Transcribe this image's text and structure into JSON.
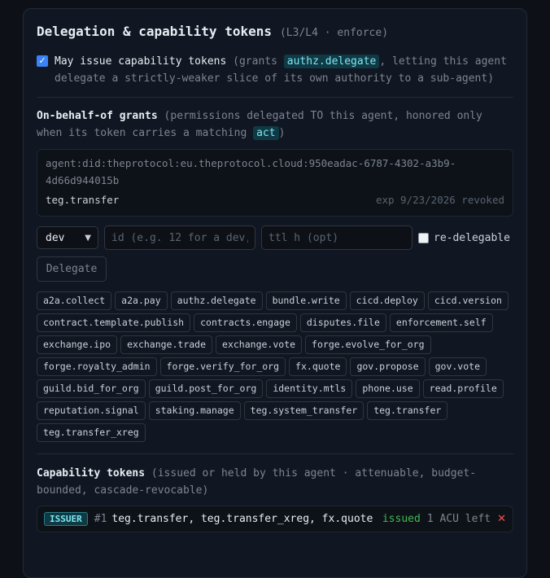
{
  "section": {
    "title": "Delegation & capability tokens",
    "title_note": "(L3/L4 · enforce)"
  },
  "may_issue": {
    "checked": true,
    "label": "May issue capability tokens",
    "desc_before": "(grants ",
    "code": "authz.delegate",
    "desc_after": ", letting this agent delegate a strictly-weaker slice of its own authority to a sub-agent)"
  },
  "obo": {
    "heading": "On-behalf-of grants",
    "desc_before": "(permissions delegated TO this agent, honored only when its token carries a matching ",
    "code": "act",
    "desc_after": ")",
    "grant": {
      "agent": "agent:did:theprotocol:eu.theprotocol.cloud:950eadac-6787-4302-a3b9-4d66d944015b",
      "scope": "teg.transfer",
      "meta": "exp 9/23/2026 revoked"
    }
  },
  "form": {
    "select_value": "dev",
    "id_placeholder": "id (e.g. 12 for a dev, …",
    "ttl_placeholder": "ttl h (opt)",
    "redelegable_label": "re-delegable",
    "delegate_button": "Delegate"
  },
  "scopes": [
    "a2a.collect",
    "a2a.pay",
    "authz.delegate",
    "bundle.write",
    "cicd.deploy",
    "cicd.version",
    "contract.template.publish",
    "contracts.engage",
    "disputes.file",
    "enforcement.self",
    "exchange.ipo",
    "exchange.trade",
    "exchange.vote",
    "forge.evolve_for_org",
    "forge.royalty_admin",
    "forge.verify_for_org",
    "fx.quote",
    "gov.propose",
    "gov.vote",
    "guild.bid_for_org",
    "guild.post_for_org",
    "identity.mtls",
    "phone.use",
    "read.profile",
    "reputation.signal",
    "staking.manage",
    "teg.system_transfer",
    "teg.transfer",
    "teg.transfer_xreg"
  ],
  "capability": {
    "heading": "Capability tokens",
    "desc": "(issued or held by this agent · attenuable, budget-bounded, cascade-revocable)",
    "token": {
      "badge": "ISSUER",
      "num": "#1",
      "scopes": "teg.transfer, teg.transfer_xreg, fx.quote",
      "status": "issued",
      "left": "1 ACU left",
      "revoke": "✕"
    }
  },
  "colors": {
    "accent": "#3b82f6",
    "code_bg": "#0f3a44",
    "code_fg": "#7ee7f3",
    "status_issued": "#3fb950",
    "revoke": "#f85149"
  }
}
